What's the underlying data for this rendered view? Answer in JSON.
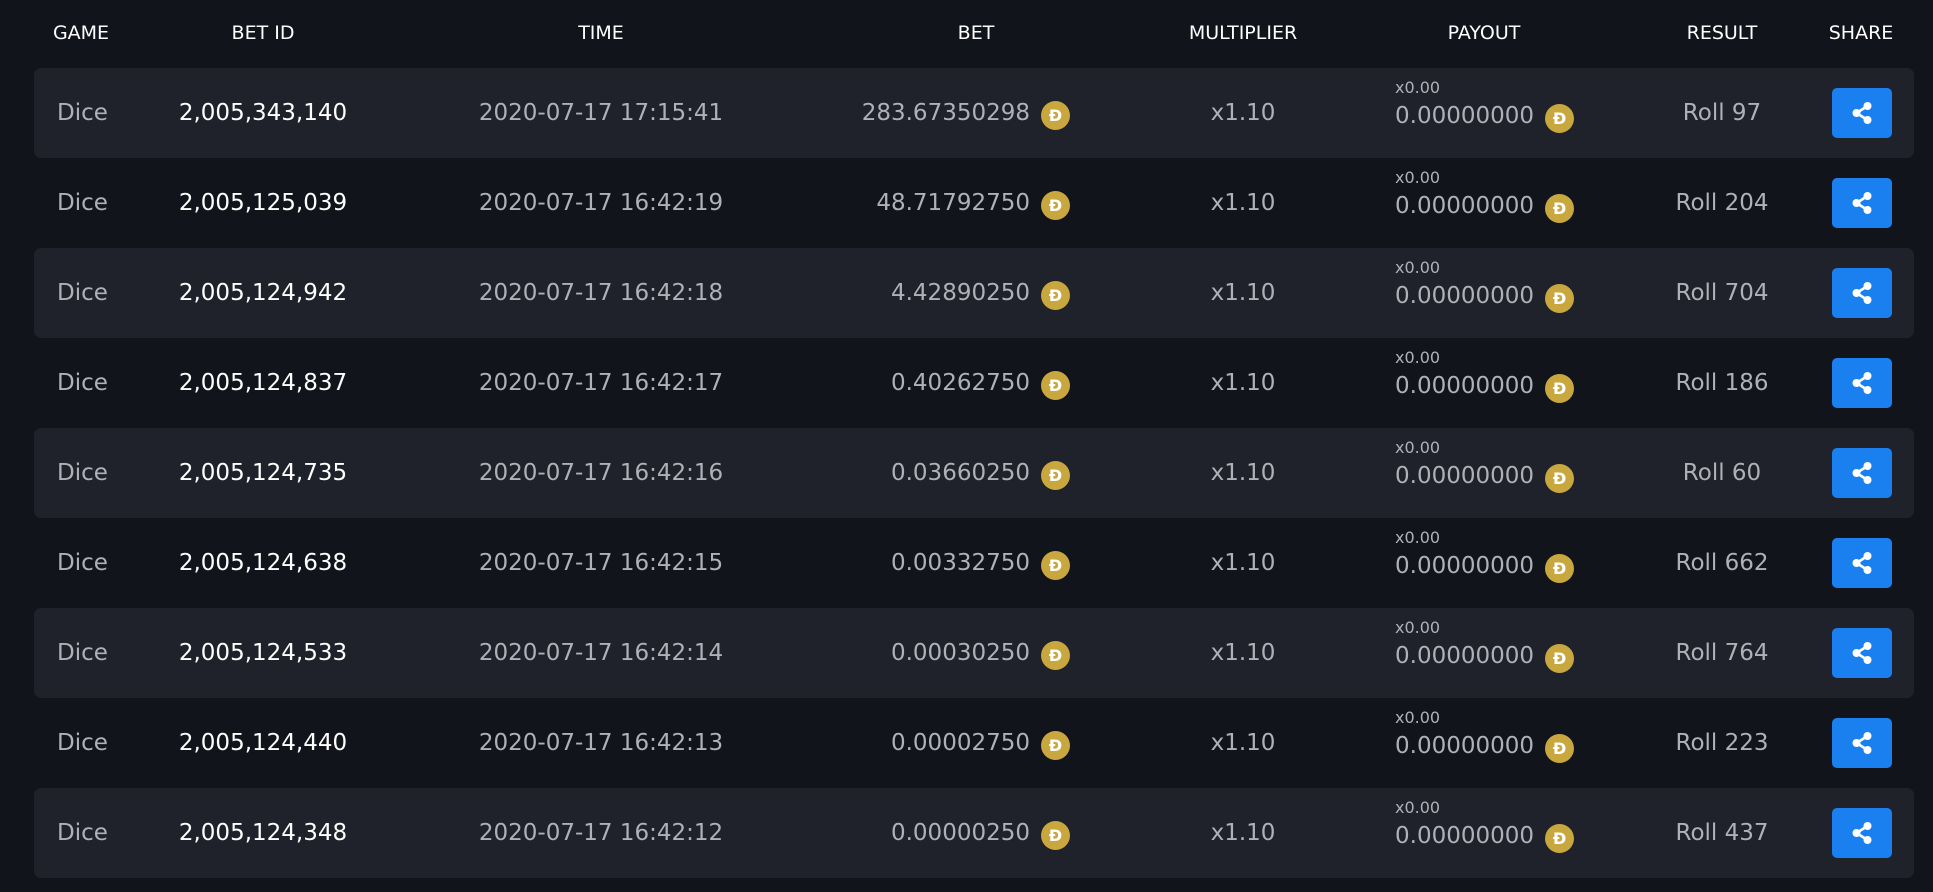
{
  "header": {
    "game": "GAME",
    "bet_id": "BET ID",
    "time": "TIME",
    "bet": "BET",
    "multiplier": "MULTIPLIER",
    "payout": "PAYOUT",
    "result": "RESULT",
    "share": "SHARE"
  },
  "currency_symbol": "Ð",
  "colors": {
    "background": "#12141c",
    "row_shade": "#1f212b",
    "coin": "#c9a73f",
    "share_button": "#1a80f0"
  },
  "rows": [
    {
      "game": "Dice",
      "bet_id": "2,005,343,140",
      "time": "2020-07-17 17:15:41",
      "bet": "283.67350298",
      "multiplier": "x1.10",
      "payout_multiplier": "x0.00",
      "payout": "0.00000000",
      "result": "Roll 97"
    },
    {
      "game": "Dice",
      "bet_id": "2,005,125,039",
      "time": "2020-07-17 16:42:19",
      "bet": "48.71792750",
      "multiplier": "x1.10",
      "payout_multiplier": "x0.00",
      "payout": "0.00000000",
      "result": "Roll 204"
    },
    {
      "game": "Dice",
      "bet_id": "2,005,124,942",
      "time": "2020-07-17 16:42:18",
      "bet": "4.42890250",
      "multiplier": "x1.10",
      "payout_multiplier": "x0.00",
      "payout": "0.00000000",
      "result": "Roll 704"
    },
    {
      "game": "Dice",
      "bet_id": "2,005,124,837",
      "time": "2020-07-17 16:42:17",
      "bet": "0.40262750",
      "multiplier": "x1.10",
      "payout_multiplier": "x0.00",
      "payout": "0.00000000",
      "result": "Roll 186"
    },
    {
      "game": "Dice",
      "bet_id": "2,005,124,735",
      "time": "2020-07-17 16:42:16",
      "bet": "0.03660250",
      "multiplier": "x1.10",
      "payout_multiplier": "x0.00",
      "payout": "0.00000000",
      "result": "Roll 60"
    },
    {
      "game": "Dice",
      "bet_id": "2,005,124,638",
      "time": "2020-07-17 16:42:15",
      "bet": "0.00332750",
      "multiplier": "x1.10",
      "payout_multiplier": "x0.00",
      "payout": "0.00000000",
      "result": "Roll 662"
    },
    {
      "game": "Dice",
      "bet_id": "2,005,124,533",
      "time": "2020-07-17 16:42:14",
      "bet": "0.00030250",
      "multiplier": "x1.10",
      "payout_multiplier": "x0.00",
      "payout": "0.00000000",
      "result": "Roll 764"
    },
    {
      "game": "Dice",
      "bet_id": "2,005,124,440",
      "time": "2020-07-17 16:42:13",
      "bet": "0.00002750",
      "multiplier": "x1.10",
      "payout_multiplier": "x0.00",
      "payout": "0.00000000",
      "result": "Roll 223"
    },
    {
      "game": "Dice",
      "bet_id": "2,005,124,348",
      "time": "2020-07-17 16:42:12",
      "bet": "0.00000250",
      "multiplier": "x1.10",
      "payout_multiplier": "x0.00",
      "payout": "0.00000000",
      "result": "Roll 437"
    }
  ]
}
